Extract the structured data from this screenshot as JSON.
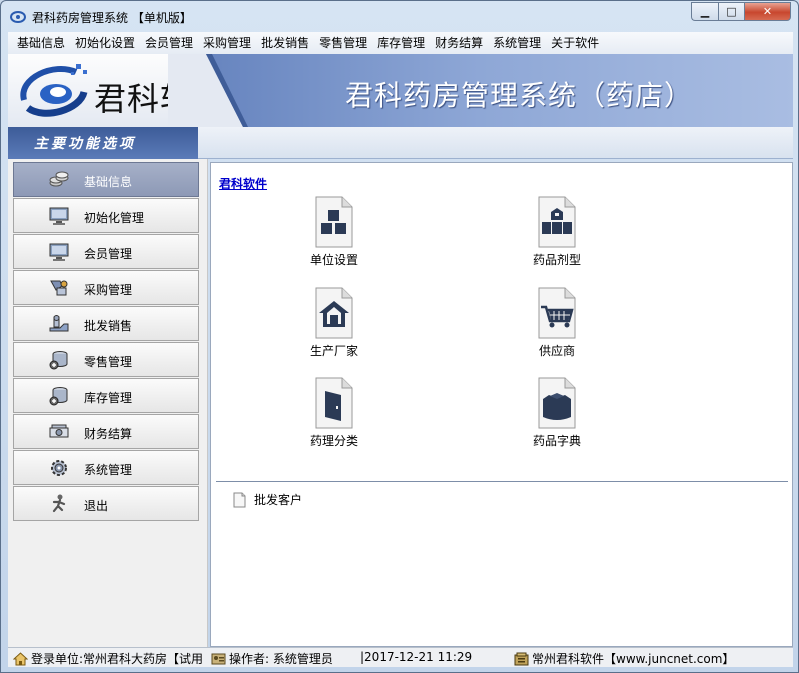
{
  "window": {
    "title": "君科药房管理系统  【单机版】",
    "controls": {
      "minimize": "▁",
      "maximize": "□",
      "close": "✕"
    }
  },
  "menubar": {
    "items": [
      "基础信息",
      "初始化设置",
      "会员管理",
      "采购管理",
      "批发销售",
      "零售管理",
      "库存管理",
      "财务结算",
      "系统管理",
      "关于软件"
    ]
  },
  "banner": {
    "logo_text": "君科软件",
    "title": "君科药房管理系统（药店）"
  },
  "sidebar": {
    "header": "主要功能选项",
    "items": [
      {
        "label": "基础信息",
        "icon": "info-coins-icon",
        "active": true
      },
      {
        "label": "初始化管理",
        "icon": "monitor-icon",
        "active": false
      },
      {
        "label": "会员管理",
        "icon": "monitor-icon",
        "active": false
      },
      {
        "label": "采购管理",
        "icon": "purchase-icon",
        "active": false
      },
      {
        "label": "批发销售",
        "icon": "wholesale-icon",
        "active": false
      },
      {
        "label": "零售管理",
        "icon": "database-icon",
        "active": false
      },
      {
        "label": "库存管理",
        "icon": "database-icon",
        "active": false
      },
      {
        "label": "财务结算",
        "icon": "money-icon",
        "active": false
      },
      {
        "label": "系统管理",
        "icon": "gear-icon",
        "active": false
      },
      {
        "label": "退出",
        "icon": "exit-runner-icon",
        "active": false
      }
    ]
  },
  "content": {
    "link": "君科软件",
    "tiles": [
      {
        "label": "单位设置",
        "icon": "blocks-icon"
      },
      {
        "label": "药品剂型",
        "icon": "box-stack-icon"
      },
      {
        "label": "生产厂家",
        "icon": "house-icon"
      },
      {
        "label": "供应商",
        "icon": "cart-icon"
      },
      {
        "label": "药理分类",
        "icon": "door-icon"
      },
      {
        "label": "药品字典",
        "icon": "book-icon"
      }
    ],
    "sub_item": "批发客户"
  },
  "statusbar": {
    "unit": "登录单位:常州君科大药房【试用",
    "operator": "操作者: 系统管理员",
    "datetime": "|2017-12-21 11:29",
    "company": "常州君科软件【www.juncnet.com】"
  },
  "colors": {
    "banner": "#6c89c2",
    "sidebar_header": "#4a6aa8",
    "active_nav": "#9aa4bf",
    "icon_dark": "#2b3a55",
    "link": "#0000cc"
  }
}
